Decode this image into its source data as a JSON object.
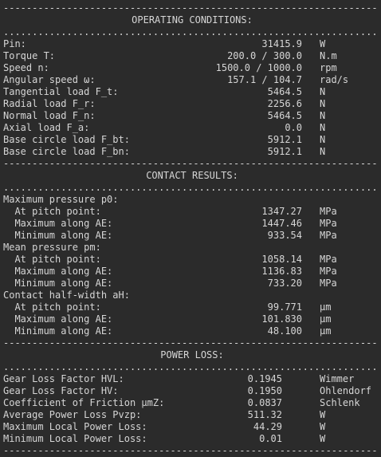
{
  "separator_dashes": "-----------------------------------------------------------------",
  "separator_dots": ".................................................................",
  "sections": [
    {
      "title": "OPERATING CONDITIONS:",
      "rows": [
        {
          "label": "Pin:",
          "value": "31415.9",
          "unit": "W"
        },
        {
          "label": "Torque T:",
          "value": "200.0 / 300.0",
          "unit": "N.m"
        },
        {
          "label": "Speed n:",
          "value": "1500.0 / 1000.0",
          "unit": "rpm"
        },
        {
          "label": "Angular speed ω:",
          "value": "157.1 / 104.7",
          "unit": "rad/s"
        },
        {
          "label": "Tangential load F_t:",
          "value": "5464.5",
          "unit": "N"
        },
        {
          "label": "Radial load F_r:",
          "value": "2256.6",
          "unit": "N"
        },
        {
          "label": "Normal load F_n:",
          "value": "5464.5",
          "unit": "N"
        },
        {
          "label": "Axial load F_a:",
          "value": "0.0",
          "unit": "N"
        },
        {
          "label": "Base circle load F_bt:",
          "value": "5912.1",
          "unit": "N"
        },
        {
          "label": "Base circle load F_bn:",
          "value": "5912.1",
          "unit": "N"
        }
      ]
    },
    {
      "title": "CONTACT RESULTS:",
      "rows": [
        {
          "label": "Maximum pressure p0:",
          "value": "",
          "unit": ""
        },
        {
          "label": "  At pitch point:",
          "value": "1347.27",
          "unit": "MPa"
        },
        {
          "label": "  Maximum along AE:",
          "value": "1447.46",
          "unit": "MPa"
        },
        {
          "label": "  Minimum along AE:",
          "value": "933.54",
          "unit": "MPa"
        },
        {
          "label": "Mean pressure pm:",
          "value": "",
          "unit": ""
        },
        {
          "label": "  At pitch point:",
          "value": "1058.14",
          "unit": "MPa"
        },
        {
          "label": "  Maximum along AE:",
          "value": "1136.83",
          "unit": "MPa"
        },
        {
          "label": "  Minimum along AE:",
          "value": "733.20",
          "unit": "MPa"
        },
        {
          "label": "Contact half-width aH:",
          "value": "",
          "unit": ""
        },
        {
          "label": "  At pitch point:",
          "value": "99.771",
          "unit": "μm"
        },
        {
          "label": "  Maximum along AE:",
          "value": "101.830",
          "unit": "μm"
        },
        {
          "label": "  Minimum along AE:",
          "value": "48.100",
          "unit": "μm"
        }
      ]
    },
    {
      "title": "POWER LOSS:",
      "rows": [
        {
          "label": "Gear Loss Factor HVL:",
          "value": "0.1945",
          "unit": "Wimmer"
        },
        {
          "label": "Gear Loss Factor HV:",
          "value": "0.1950",
          "unit": "Ohlendorf"
        },
        {
          "label": "Coefficient of Friction μmZ:",
          "value": "0.0837",
          "unit": "Schlenk"
        },
        {
          "label": "Average Power Loss Pvzp:",
          "value": "511.32",
          "unit": "W"
        },
        {
          "label": "Maximum Local Power Loss:",
          "value": "44.29",
          "unit": "W"
        },
        {
          "label": "Minimum Local Power Loss:",
          "value": "0.01",
          "unit": "W"
        }
      ]
    }
  ]
}
